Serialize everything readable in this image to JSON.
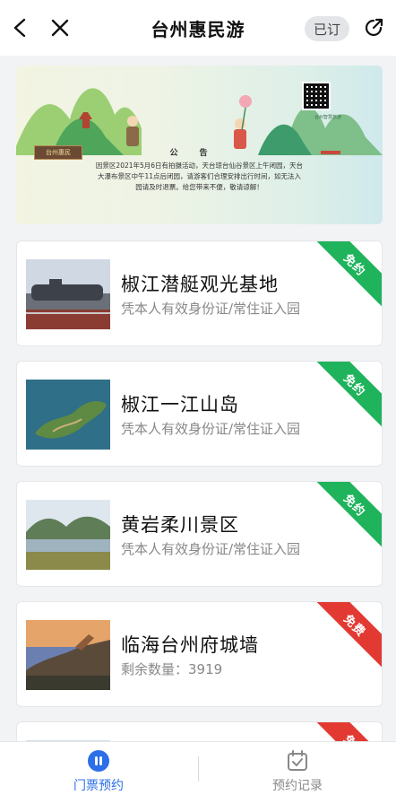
{
  "header": {
    "title": "台州惠民游",
    "booked_label": "已订",
    "icons": [
      "back-icon",
      "close-icon",
      "share-icon"
    ]
  },
  "banner": {
    "seal_text": "台州惠民",
    "notice_title": "公告",
    "notice_body": "因景区2021年5月6日有拍摄活动，天台琼台仙谷景区上午闭园，天台大瀑布景区中午11点后闭园，请游客们合理安排出行时间，如无法入园请及时退票。给您带来不便，敬请谅解！",
    "qr_caption": "台州智慧旅游"
  },
  "cards": [
    {
      "title": "椒江潜艇观光基地",
      "subtitle": "凭本人有效身份证/常住证入园",
      "badge": "免约",
      "badge_color": "#1fb35c"
    },
    {
      "title": "椒江一江山岛",
      "subtitle": "凭本人有效身份证/常住证入园",
      "badge": "免约",
      "badge_color": "#1fb35c"
    },
    {
      "title": "黄岩柔川景区",
      "subtitle": "凭本人有效身份证/常住证入园",
      "badge": "免约",
      "badge_color": "#1fb35c"
    },
    {
      "title": "临海台州府城墙",
      "subtitle": "剩余数量：3919",
      "badge": "免费",
      "badge_color": "#e23a33"
    },
    {
      "title": "",
      "subtitle": "",
      "badge": "免费",
      "badge_color": "#e23a33"
    }
  ],
  "bottom_nav": {
    "tickets_label": "门票预约",
    "records_label": "预约记录",
    "active_color": "#2c6fe8"
  }
}
